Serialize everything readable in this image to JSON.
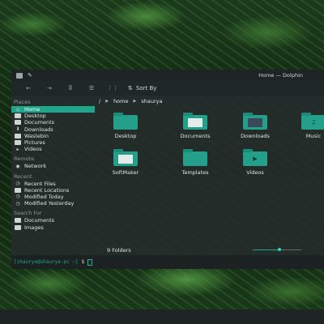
{
  "window": {
    "title": "Home — Dolphin"
  },
  "toolbar": {
    "back": "←",
    "forward": "→",
    "view_icons": "⠿",
    "view_compact": "☰",
    "view_details": "⋮⋮",
    "sort_label": "Sort By"
  },
  "sidebar": {
    "places_label": "Places",
    "places": [
      {
        "label": "Home",
        "icon": "home-icon"
      },
      {
        "label": "Desktop",
        "icon": "desktop-icon"
      },
      {
        "label": "Documents",
        "icon": "documents-icon"
      },
      {
        "label": "Downloads",
        "icon": "downloads-icon"
      },
      {
        "label": "Wastebin",
        "icon": "trash-icon"
      },
      {
        "label": "Pictures",
        "icon": "pictures-icon"
      },
      {
        "label": "Videos",
        "icon": "videos-icon"
      }
    ],
    "remote_label": "Remote",
    "remote": [
      {
        "label": "Network",
        "icon": "network-icon"
      }
    ],
    "recent_label": "Recent",
    "recent": [
      {
        "label": "Recent Files",
        "icon": "recent-files-icon"
      },
      {
        "label": "Recent Locations",
        "icon": "recent-locations-icon"
      },
      {
        "label": "Modified Today",
        "icon": "clock-icon"
      },
      {
        "label": "Modified Yesterday",
        "icon": "clock-icon"
      }
    ],
    "search_label": "Search For",
    "search": [
      {
        "label": "Documents",
        "icon": "documents-icon"
      },
      {
        "label": "Images",
        "icon": "images-icon"
      }
    ]
  },
  "breadcrumb": {
    "root": "/",
    "items": [
      "home",
      "shaurya"
    ]
  },
  "folders": [
    {
      "label": "Desktop",
      "kind": "plain"
    },
    {
      "label": "Documents",
      "kind": "thumb"
    },
    {
      "label": "Downloads",
      "kind": "thumb"
    },
    {
      "label": "Music",
      "kind": "music"
    },
    {
      "label": "SoftMaker",
      "kind": "thumb"
    },
    {
      "label": "Templates",
      "kind": "plain"
    },
    {
      "label": "Videos",
      "kind": "video"
    }
  ],
  "status": {
    "count": "9 Folders",
    "zoom_fraction": 0.55
  },
  "terminal": {
    "prompt": "[shaurya@shaurya-pc ~]",
    "symbol": "$"
  },
  "colors": {
    "accent": "#1fa58c"
  }
}
